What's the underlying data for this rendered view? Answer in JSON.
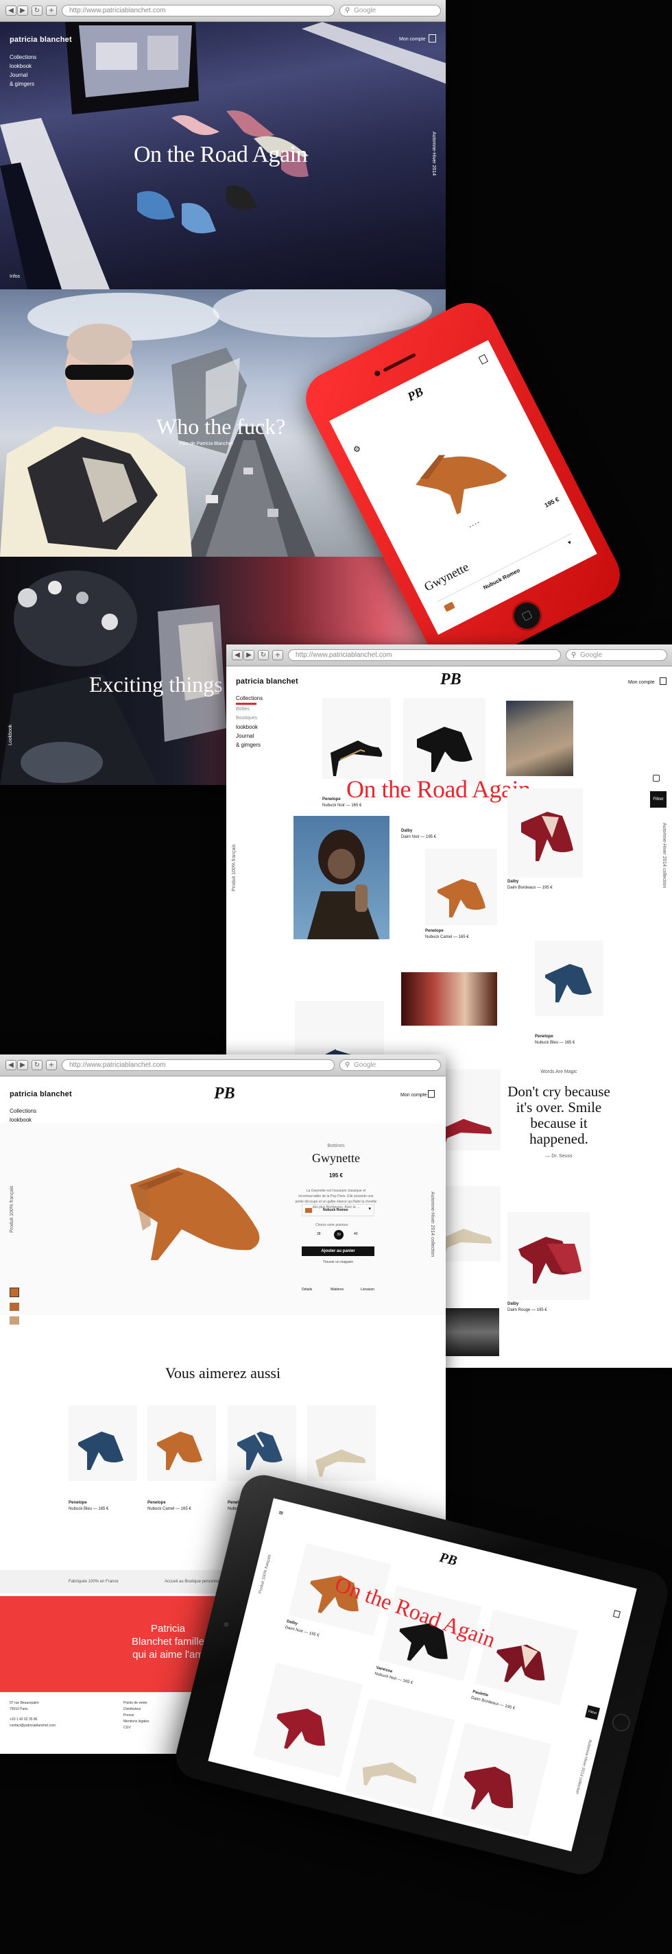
{
  "browser": {
    "url": "http://www.patriciablanchet.com",
    "search_placeholder": "Google"
  },
  "brand": "patricia blanchet",
  "monogram": "PB",
  "nav": [
    "Collections",
    "lookbook",
    "Journal",
    "& gimgers"
  ],
  "nav_collections_sub": [
    "Bottes",
    "Boutiques"
  ],
  "hero": {
    "slides": [
      {
        "headline": "On the Road Again",
        "vertical_caption": "Automne-Hiver 2014"
      },
      {
        "headline": "Who the fuck?",
        "subline": "Film de Patricia Blanchet"
      },
      {
        "headline": "Exciting things",
        "vertical_caption": "Lookbook"
      }
    ],
    "account": "Mon compte",
    "scroll_label": "Infos"
  },
  "catalog": {
    "overlay_title": "On the Road Again",
    "left_vertical": "Produit 100% français",
    "right_vertical": "Automne-Hiver 2014 collection",
    "filter_label": "Filtrer",
    "quote_eyebrow": "Words Are Magic",
    "quote": "Don't cry because it's over. Smile because it happened.",
    "quote_author": "— Dr. Seuss",
    "products": [
      {
        "name": "Penelope",
        "meta": "Nubuck Noir — 165 €"
      },
      {
        "name": "Dalby",
        "meta": "Daim Noir — 195 €"
      },
      {
        "name": "Dalby",
        "meta": "Daim Bordeaux — 195 €"
      },
      {
        "name": "Penelope",
        "meta": "Nubuck Camel — 165 €"
      },
      {
        "name": "Penelope",
        "meta": "Nubuck Bleu — 165 €"
      },
      {
        "name": "Dalby",
        "meta": "Daim Rouge — 195 €"
      }
    ]
  },
  "product_page": {
    "eyebrow": "Bottines",
    "name": "Gwynette",
    "price": "195 €",
    "description": "La Gwynette est l'escarpin classique et incontournable de la Pep Paris. Elle possède une petite découpe et un galbe élancé qui flatte la cheville des plus Bonheures. Avec le ...",
    "color_label": "Nubuck Romeo",
    "size_label": "Choisir votre pointure",
    "sizes": [
      "38",
      "39",
      "40"
    ],
    "size_selected": "39",
    "add_to_cart": "Ajouter au panier",
    "find_store": "Trouver un magasin",
    "tabs": [
      "Détails",
      "Matières",
      "Livraison"
    ],
    "left_vertical": "Produit 100% français",
    "right_vertical": "Automne-Hiver 2014 collection",
    "related_title": "Vous aimerez aussi",
    "related": [
      {
        "name": "Penelope",
        "meta": "Nubuck Bleu — 165 €"
      },
      {
        "name": "Penelope",
        "meta": "Nubuck Camel — 165 €"
      },
      {
        "name": "Penelope",
        "meta": "Nubuck Bleu — 165 €"
      }
    ],
    "footer_band": [
      "Fabriquée 100% en France",
      "Accueil au Boutique personnalisé"
    ],
    "red_banner": "Patricia Blanchet famille qui ai aime l'am",
    "footer_address": [
      "97 rue Beaurepaire",
      "75010 Paris",
      "+33 1 42 02 35 86",
      "contact@patriciablanchet.com"
    ],
    "footer_col2": [
      "Points de vente",
      "Distributeur",
      "Presse",
      "Mentions légales",
      "CGV"
    ]
  },
  "phone": {
    "product_name": "Gwynette",
    "price": "195 €",
    "color_label": "Nubuck Romeo",
    "pager": "• • • •"
  },
  "tablet": {
    "overlay_title": "On the Road Again",
    "left_vertical": "Produit 100% français",
    "right_vertical": "Automne-Hiver 2014 collection",
    "filter_label": "Filtrer",
    "captions": [
      {
        "name": "Dalby",
        "meta": "Daim Noir — 195 €"
      },
      {
        "name": "Vanessa",
        "meta": "Nubuck Noir — 165 €"
      },
      {
        "name": "Paulette",
        "meta": "Daim Bordeaux — 195 €"
      }
    ]
  },
  "colors": {
    "accent_red": "#e8262b",
    "red_banner": "#ef3b39",
    "phone_red": "#e01818",
    "background": "#050505",
    "camel": "#c06a2e",
    "navy": "#27476b",
    "burgundy": "#8d1826"
  }
}
